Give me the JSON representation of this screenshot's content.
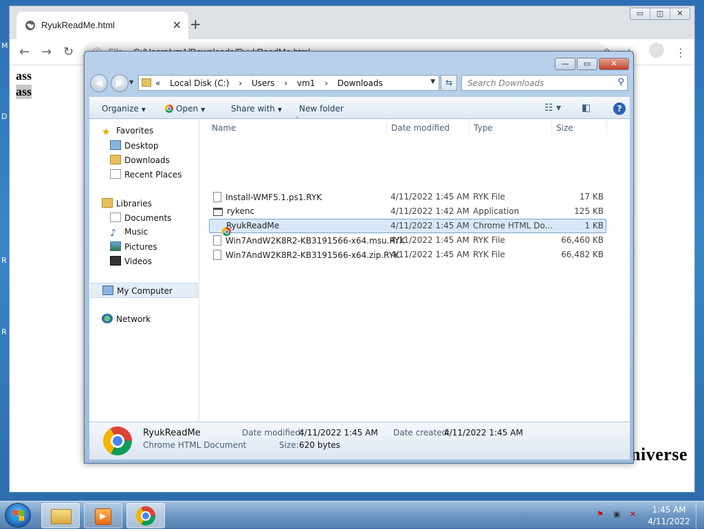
{
  "desktop": {
    "labels": [
      "M",
      "D",
      "R",
      "R"
    ]
  },
  "chrome": {
    "tab_title": "RyukReadMe.html",
    "tab_close": "✕",
    "new_tab": "+",
    "window_controls": [
      "▭",
      "◫",
      "✕"
    ],
    "scheme": "File",
    "url": "C:/Users/vm1/Downloads/RyukReadMe.html",
    "page": {
      "line1": "ass",
      "line2": "ass",
      "footer": "balance of shadow universe"
    }
  },
  "explorer": {
    "window_controls": [
      "—",
      "▭",
      "✕"
    ],
    "address": {
      "prefix": "«",
      "crumbs": [
        "Local Disk (C:)",
        "Users",
        "vm1",
        "Downloads"
      ],
      "separator": "›"
    },
    "search_placeholder": "Search Downloads",
    "toolbar": {
      "organize": "Organize",
      "open": "Open",
      "share_with": "Share with",
      "new_folder": "New folder",
      "help": "?"
    },
    "nav": {
      "favorites": "Favorites",
      "desktop": "Desktop",
      "downloads": "Downloads",
      "recent_places": "Recent Places",
      "libraries": "Libraries",
      "documents": "Documents",
      "music": "Music",
      "pictures": "Pictures",
      "videos": "Videos",
      "my_computer": "My Computer",
      "network": "Network"
    },
    "columns": {
      "name": "Name",
      "date_modified": "Date modified",
      "type": "Type",
      "size": "Size"
    },
    "files": [
      {
        "name": "Install-WMF5.1.ps1.RYK",
        "date": "4/11/2022 1:45 AM",
        "type": "RYK File",
        "size": "17 KB",
        "icon": "file-icon"
      },
      {
        "name": "rykenc",
        "date": "4/11/2022 1:42 AM",
        "type": "Application",
        "size": "125 KB",
        "icon": "application-icon"
      },
      {
        "name": "RyukReadMe",
        "date": "4/11/2022 1:45 AM",
        "type": "Chrome HTML Do...",
        "size": "1 KB",
        "icon": "chrome-icon",
        "selected": true
      },
      {
        "name": "Win7AndW2K8R2-KB3191566-x64.msu.RYK",
        "date": "4/11/2022 1:45 AM",
        "type": "RYK File",
        "size": "66,460 KB",
        "icon": "file-icon"
      },
      {
        "name": "Win7AndW2K8R2-KB3191566-x64.zip.RYK",
        "date": "4/11/2022 1:45 AM",
        "type": "RYK File",
        "size": "66,482 KB",
        "icon": "file-icon"
      }
    ],
    "details": {
      "name": "RyukReadMe",
      "kind": "Chrome HTML Document",
      "date_modified_label": "Date modified:",
      "date_modified": "4/11/2022 1:45 AM",
      "date_created_label": "Date created:",
      "date_created": "4/11/2022 1:45 AM",
      "size_label": "Size:",
      "size": "620 bytes"
    }
  },
  "taskbar": {
    "time": "1:45 AM",
    "date": "4/11/2022"
  }
}
